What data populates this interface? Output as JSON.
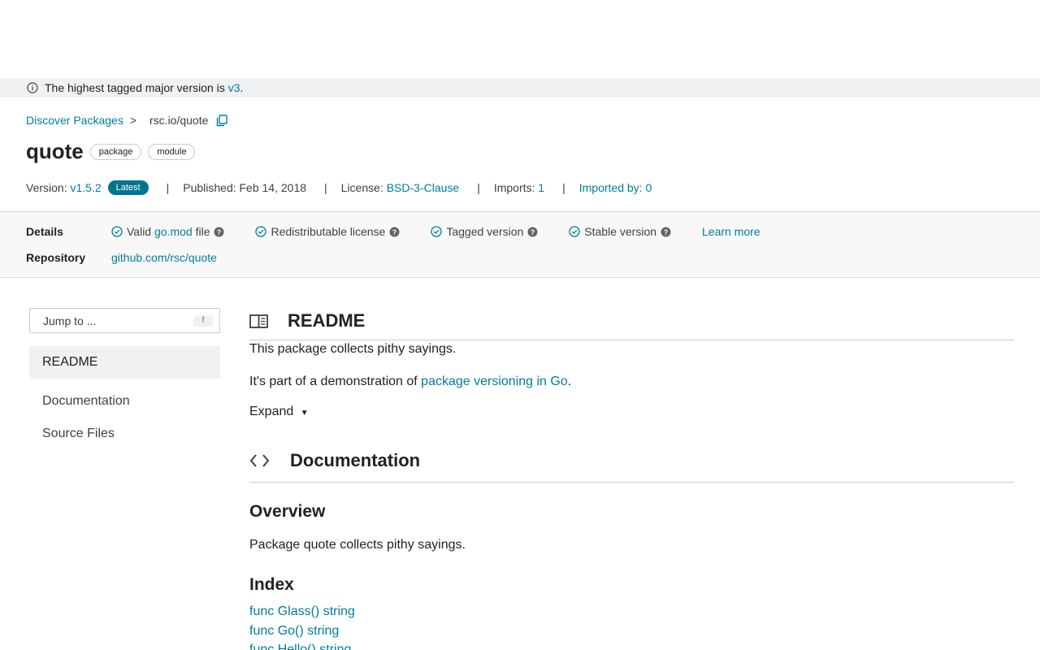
{
  "banner": {
    "text": "The highest tagged major version is ",
    "link": "v3",
    "suffix": "."
  },
  "breadcrumb": {
    "root": "Discover Packages",
    "separator": ">",
    "current": "rsc.io/quote"
  },
  "header": {
    "title": "quote",
    "chips": [
      "package",
      "module"
    ]
  },
  "meta": {
    "version_label": "Version: ",
    "version": "v1.5.2",
    "latest": "Latest",
    "bar": "|",
    "published_label": "Published: Feb 14, 2018",
    "license_label": "License: ",
    "license": "BSD-3-Clause",
    "imports_label": "Imports: ",
    "imports": "1",
    "imported_by": "Imported by: 0"
  },
  "details": {
    "label": "Details",
    "badges": {
      "valid_prefix": "Valid ",
      "valid_link": "go.mod",
      "valid_suffix": " file",
      "redistributable": "Redistributable license",
      "tagged": "Tagged version",
      "stable": "Stable version"
    },
    "learn_more": "Learn more",
    "repository_label": "Repository",
    "repository": "github.com/rsc/quote"
  },
  "sidebar": {
    "jump_placeholder": "Jump to ...",
    "jump_key": "f",
    "items": [
      "README",
      "Documentation",
      "Source Files"
    ]
  },
  "readme": {
    "title": "README",
    "line1": "This package collects pithy sayings.",
    "line2_prefix": "It's part of a demonstration of ",
    "line2_link": "package versioning in Go",
    "line2_suffix": ".",
    "expand": "Expand"
  },
  "documentation": {
    "title": "Documentation",
    "overview_title": "Overview",
    "overview_text": "Package quote collects pithy sayings.",
    "index_title": "Index",
    "index_items": [
      "func Glass() string",
      "func Go() string",
      "func Hello() string"
    ]
  },
  "colors": {
    "link": "#007d9c",
    "latest_badge": "#00758f",
    "banner_bg": "#f0f1f2"
  }
}
